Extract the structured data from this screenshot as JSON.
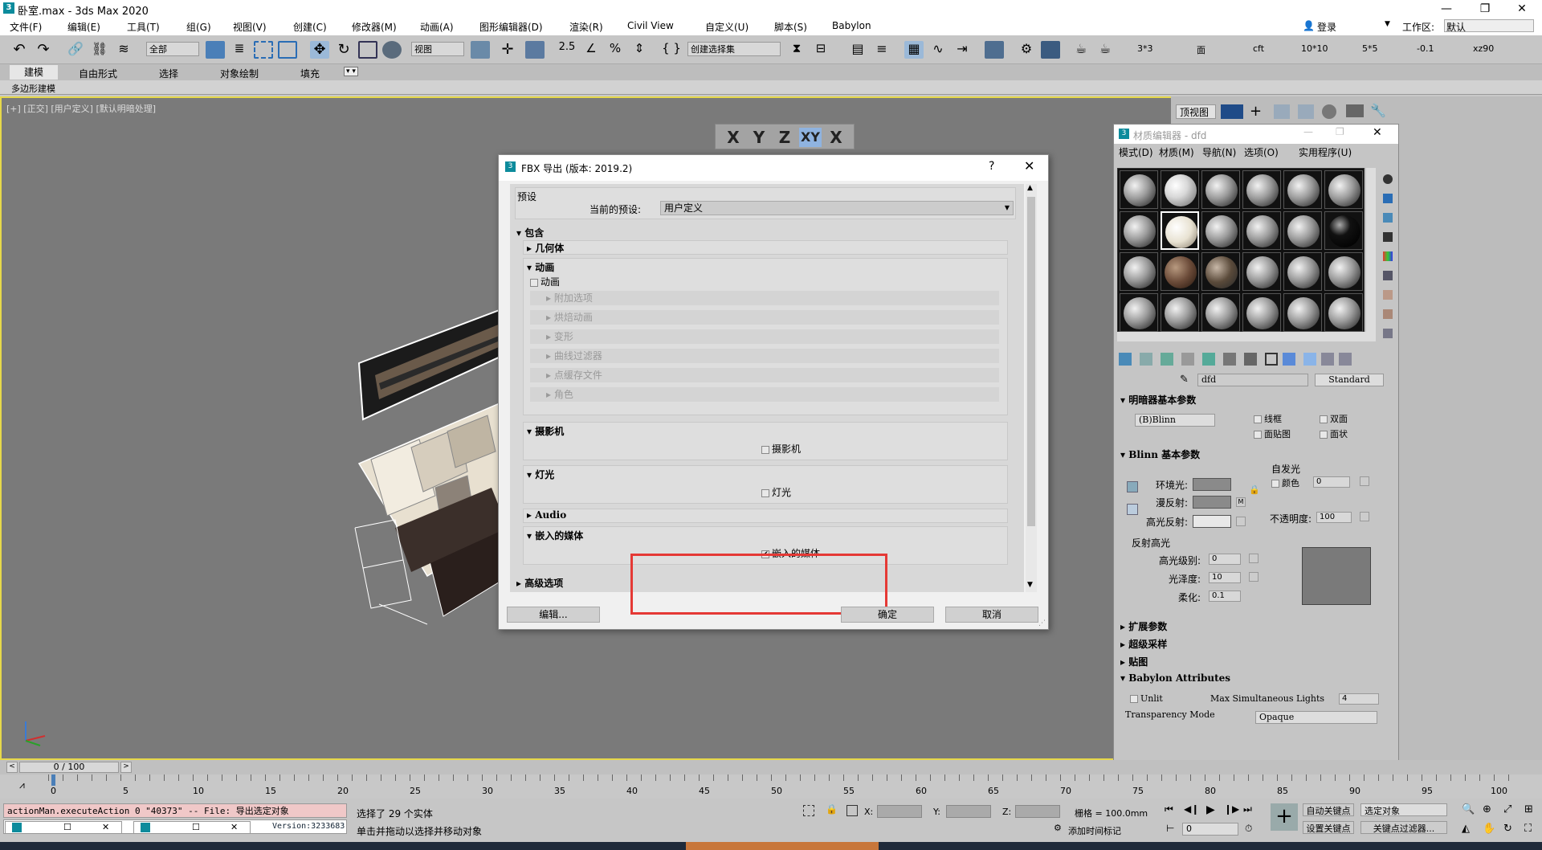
{
  "app": {
    "window_title": "卧室.max - 3ds Max 2020",
    "win_buttons": [
      "—",
      "❐",
      "✕"
    ]
  },
  "menu": {
    "items": [
      "文件(F)",
      "编辑(E)",
      "工具(T)",
      "组(G)",
      "视图(V)",
      "创建(C)",
      "修改器(M)",
      "动画(A)",
      "图形编辑器(D)",
      "渲染(R)",
      "Civil View",
      "自定义(U)",
      "脚本(S)",
      "Babylon"
    ],
    "login": "登录",
    "workspace_label": "工作区:",
    "workspace_value": "默认"
  },
  "toolbar": {
    "filter": "全部",
    "view": "视图",
    "selection_set": "创建选择集",
    "right_labels": [
      "3*3",
      "面",
      "cft",
      "10*10",
      "5*5",
      "-0.1",
      "xz90"
    ]
  },
  "ribbon": {
    "tabs": [
      "建模",
      "自由形式",
      "选择",
      "对象绘制",
      "填充"
    ],
    "sub": "多边形建模"
  },
  "viewport": {
    "label": "[+] [正交] [用户定义] [默认明暗处理]",
    "axes": [
      "X",
      "Y",
      "Z",
      "XY",
      "X"
    ]
  },
  "right_panel": {
    "view_label": "顶视图"
  },
  "fbx_dialog": {
    "title": "FBX 导出 (版本: 2019.2)",
    "help": "?",
    "close": "✕",
    "preset_group": "预设",
    "preset_label": "当前的预设:",
    "preset_value": "用户定义",
    "include": "包含",
    "geometry": "几何体",
    "animation": "动画",
    "animation_checkbox": "动画",
    "anim_subs": [
      "附加选项",
      "烘焙动画",
      "变形",
      "曲线过滤器",
      "点缓存文件",
      "角色"
    ],
    "camera": "摄影机",
    "camera_checkbox": "摄影机",
    "light": "灯光",
    "light_checkbox": "灯光",
    "audio": "Audio",
    "embed": "嵌入的媒体",
    "embed_checkbox": "嵌入的媒体",
    "advanced": "高级选项",
    "edit_button": "编辑...",
    "ok_button": "确定",
    "cancel_button": "取消"
  },
  "material_editor": {
    "title": "材质编辑器 - dfd",
    "menus": [
      "模式(D)",
      "材质(M)",
      "导航(N)",
      "选项(O)",
      "实用程序(U)"
    ],
    "material_name": "dfd",
    "material_type": "Standard",
    "shader_section": "明暗器基本参数",
    "shader": "(B)Blinn",
    "wire": "线框",
    "two_sided": "双面",
    "face_map": "面贴图",
    "faceted": "面状",
    "blinn_section": "Blinn 基本参数",
    "self_illum": "自发光",
    "color_label": "颜色",
    "color_value": "0",
    "ambient": "环境光:",
    "diffuse": "漫反射:",
    "specular": "高光反射:",
    "m_label": "M",
    "opacity_label": "不透明度:",
    "opacity_value": "100",
    "spec_high": "反射高光",
    "spec_level": "高光级别:",
    "spec_level_value": "0",
    "gloss": "光泽度:",
    "gloss_value": "10",
    "soften": "柔化:",
    "soften_value": "0.1",
    "rollouts": [
      "扩展参数",
      "超级采样",
      "贴图",
      "Babylon Attributes"
    ],
    "unlit": "Unlit",
    "max_lights_label": "Max Simultaneous Lights",
    "max_lights_value": "4",
    "transparency_label": "Transparency Mode",
    "transparency_value": "Opaque"
  },
  "timeline": {
    "frame": "0 / 100",
    "ticks": [
      "0",
      "5",
      "10",
      "15",
      "20",
      "25",
      "30",
      "35",
      "40",
      "45",
      "50",
      "55",
      "60",
      "65",
      "70",
      "75",
      "80",
      "85",
      "90",
      "95",
      "100"
    ]
  },
  "status": {
    "script_line1": "actionMan.executeAction 0 \"40373\"  -- File: 导出选定对象",
    "script_line2": "Version:3233683",
    "selected": "选择了 29 个实体",
    "hint": "单击并拖动以选择并移动对象",
    "x_label": "X:",
    "y_label": "Y:",
    "z_label": "Z:",
    "grid": "栅格 = 100.0mm",
    "add_time_tag": "添加时间标记",
    "auto_key": "自动关键点",
    "selected_obj": "选定对象",
    "set_key": "设置关键点",
    "key_filter": "关键点过滤器...",
    "frame_field": "0"
  }
}
